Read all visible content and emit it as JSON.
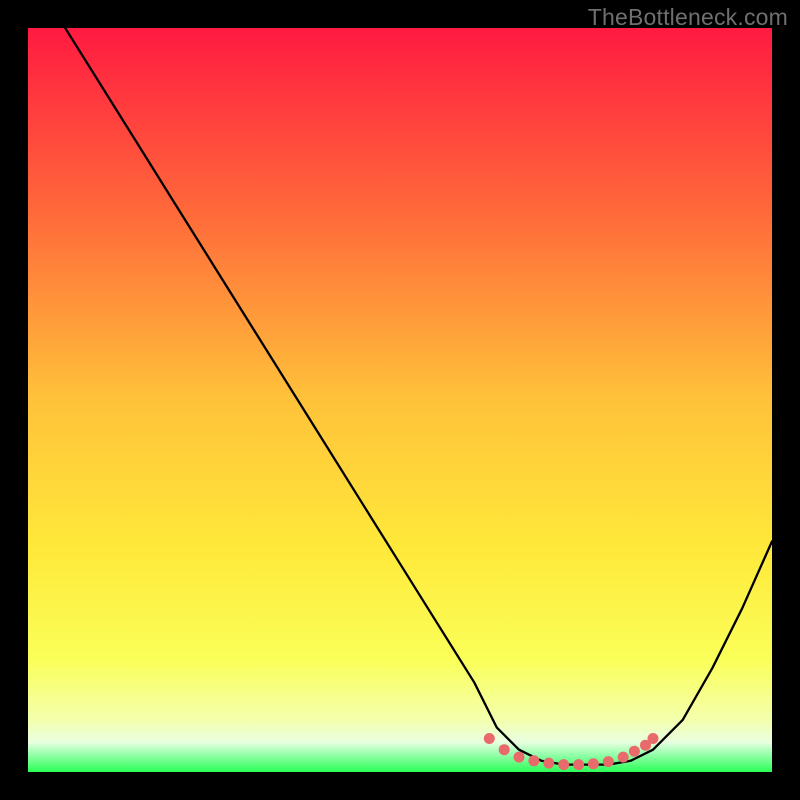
{
  "watermark": "TheBottleneck.com",
  "colors": {
    "bg": "#000000",
    "grad_top": "#ff1a41",
    "grad_mid1": "#ff7a3a",
    "grad_mid2": "#ffd93a",
    "grad_low": "#faff59",
    "grad_pale": "#f7ffb3",
    "grad_green": "#2bff57",
    "curve": "#000000",
    "marker": "#e96a6a"
  },
  "chart_data": {
    "type": "line",
    "title": "",
    "xlabel": "",
    "ylabel": "",
    "xlim": [
      0,
      100
    ],
    "ylim": [
      0,
      100
    ],
    "series": [
      {
        "name": "bottleneck-curve",
        "x": [
          5,
          10,
          15,
          20,
          25,
          30,
          35,
          40,
          45,
          50,
          55,
          60,
          63,
          66,
          69,
          72,
          75,
          78,
          81,
          84,
          88,
          92,
          96,
          100
        ],
        "y": [
          100,
          92,
          84,
          76,
          68,
          60,
          52,
          44,
          36,
          28,
          20,
          12,
          6,
          3,
          1.5,
          1,
          1,
          1,
          1.5,
          3,
          7,
          14,
          22,
          31
        ]
      }
    ],
    "markers": {
      "name": "flat-region",
      "x": [
        62,
        64,
        66,
        68,
        70,
        72,
        74,
        76,
        78,
        80,
        81.5,
        83,
        84
      ],
      "y": [
        4.5,
        3,
        2,
        1.5,
        1.2,
        1,
        1,
        1.1,
        1.4,
        2,
        2.8,
        3.6,
        4.5
      ]
    }
  }
}
